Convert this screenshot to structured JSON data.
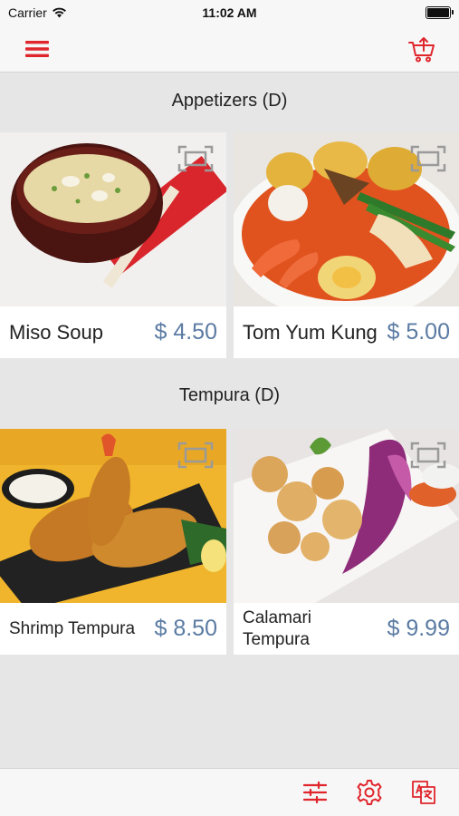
{
  "status_bar": {
    "carrier": "Carrier",
    "time": "11:02 AM"
  },
  "nav": {
    "menu_icon": "hamburger-menu-icon",
    "cart_icon": "shopping-cart-icon"
  },
  "accent_color": "#e0262d",
  "price_color": "#5b7ba3",
  "sections": [
    {
      "title": "Appetizers (D)",
      "items": [
        {
          "name": "Miso Soup",
          "price": "$ 4.50"
        },
        {
          "name": "Tom Yum Kung",
          "price": "$ 5.00"
        }
      ]
    },
    {
      "title": "Tempura (D)",
      "items": [
        {
          "name": "Shrimp Tempura",
          "price": "$ 8.50"
        },
        {
          "name": "Calamari Tempura",
          "price": "$ 9.99"
        }
      ]
    }
  ],
  "tab_bar": {
    "icons": [
      "filter-sliders-icon",
      "settings-gear-icon",
      "translate-icon"
    ]
  }
}
